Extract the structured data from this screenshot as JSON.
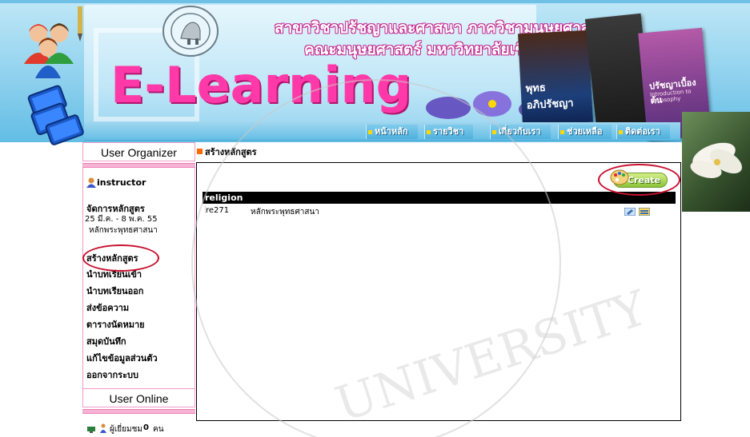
{
  "header": {
    "title_line1": "สาขาวิชาปรัชญาและศาสนา ภาควิชามนุษยศาสตร์",
    "title_line2": "คณะมนุษยศาสตร์ มหาวิทยาลัยเชียงใหม่",
    "brand": "E-Learning",
    "book1_title": "พุทธอภิปรัชญา",
    "book2_title": "ปรัชญาเบื้องต้น",
    "book2_subtitle": "Introduction to Philosophy"
  },
  "nav": {
    "items": [
      {
        "label": "หน้าหลัก"
      },
      {
        "label": "รายวิชา"
      },
      {
        "label": "เกี่ยวกับเรา"
      },
      {
        "label": "ช่วยเหลือ"
      },
      {
        "label": "ติดต่อเรา"
      }
    ]
  },
  "sidebar": {
    "organizer_title": "User Organizer",
    "username": "instructor",
    "manage_label": "จัดการหลักสูตร",
    "date_range": "25 มี.ค. - 8 พ.ค. 55",
    "course_name": "หลักพระพุทธศาสนา",
    "menu": [
      {
        "label": "สร้างหลักสูตร"
      },
      {
        "label": "นำบทเรียนเข้า"
      },
      {
        "label": "นำบทเรียนออก"
      },
      {
        "label": "ส่งข้อความ"
      },
      {
        "label": "ตารางนัดหมาย"
      },
      {
        "label": "สมุดบันทึก"
      },
      {
        "label": "แก้ไขข้อมูลส่วนตัว"
      },
      {
        "label": "ออกจากระบบ"
      }
    ],
    "online_title": "User Online",
    "visitors_text": "ผู้เยี่ยมชม",
    "visitors_count": "0",
    "visitors_unit": "คน"
  },
  "main": {
    "page_title": "สร้างหลักสูตร",
    "create_label": "Create",
    "category": "religion",
    "courses": [
      {
        "code": "re271",
        "name": "หลักพระพุทธศาสนา"
      }
    ]
  },
  "watermark": {
    "text": "UNIVERSITY"
  },
  "colors": {
    "accent_pink": "#ff3aa8",
    "banner_blue": "#8fd1ee",
    "panel_border": "#f09cc7",
    "highlight_red": "#c8102e",
    "create_green": "#8bc33a"
  }
}
